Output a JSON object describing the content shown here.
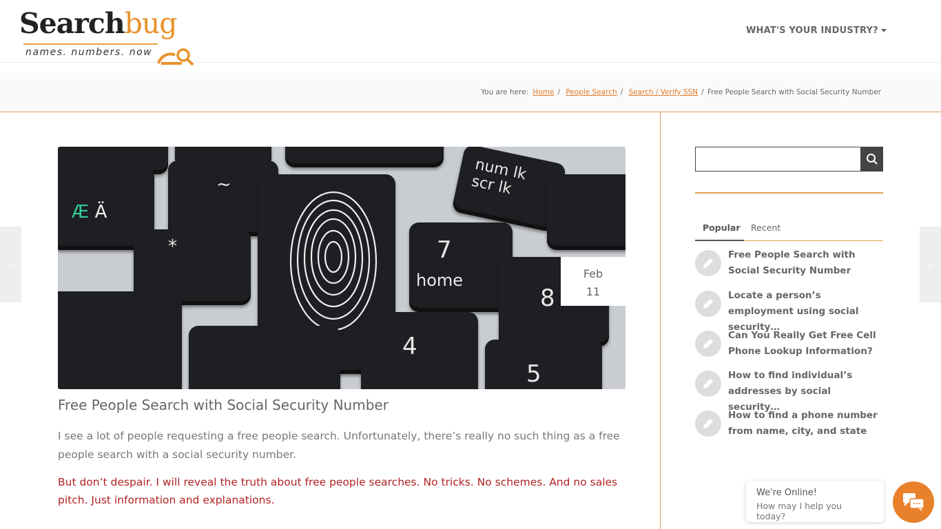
{
  "header": {
    "logo_main": "Search",
    "logo_accent": "bug",
    "logo_tagline": "names. numbers. now",
    "industry_menu": "WHAT'S YOUR INDUSTRY?"
  },
  "breadcrumb": {
    "prefix": "You are here:",
    "items": [
      "Home",
      "People Search",
      "Search / Verify SSN"
    ],
    "current": "Free People Search with Social Security Number"
  },
  "post": {
    "date_month": "Feb",
    "date_day": "11",
    "title": "Free People Search with Social Security Number",
    "paragraph1": "I see a lot of people requesting a free people search. Unfortunately, there’s really no such thing as a free people search with a social security number.",
    "paragraph2": "But don’t despair. I will reveal the truth about free people searches. No tricks. No schemes. And no sales pitch. Just information and explanations.",
    "image_key_labels": [
      "num lk",
      "scr lk",
      "7",
      "home",
      "8",
      "4",
      "5",
      "*",
      "Æ",
      "Ä",
      "~"
    ]
  },
  "sidebar": {
    "search_placeholder": "",
    "tabs": [
      "Popular",
      "Recent"
    ],
    "posts": [
      "Free People Search with Social Security Number",
      "Locate a person’s employment using social security…",
      "Can You Really Get Free Cell Phone Lookup Information?",
      "How to find individual’s addresses by social security…",
      "How to find a phone number from name, city, and state"
    ]
  },
  "chat": {
    "title": "We're Online!",
    "subtitle": "How may I help you today?"
  },
  "colors": {
    "accent": "#e8812a",
    "alert_text": "#b22222"
  }
}
